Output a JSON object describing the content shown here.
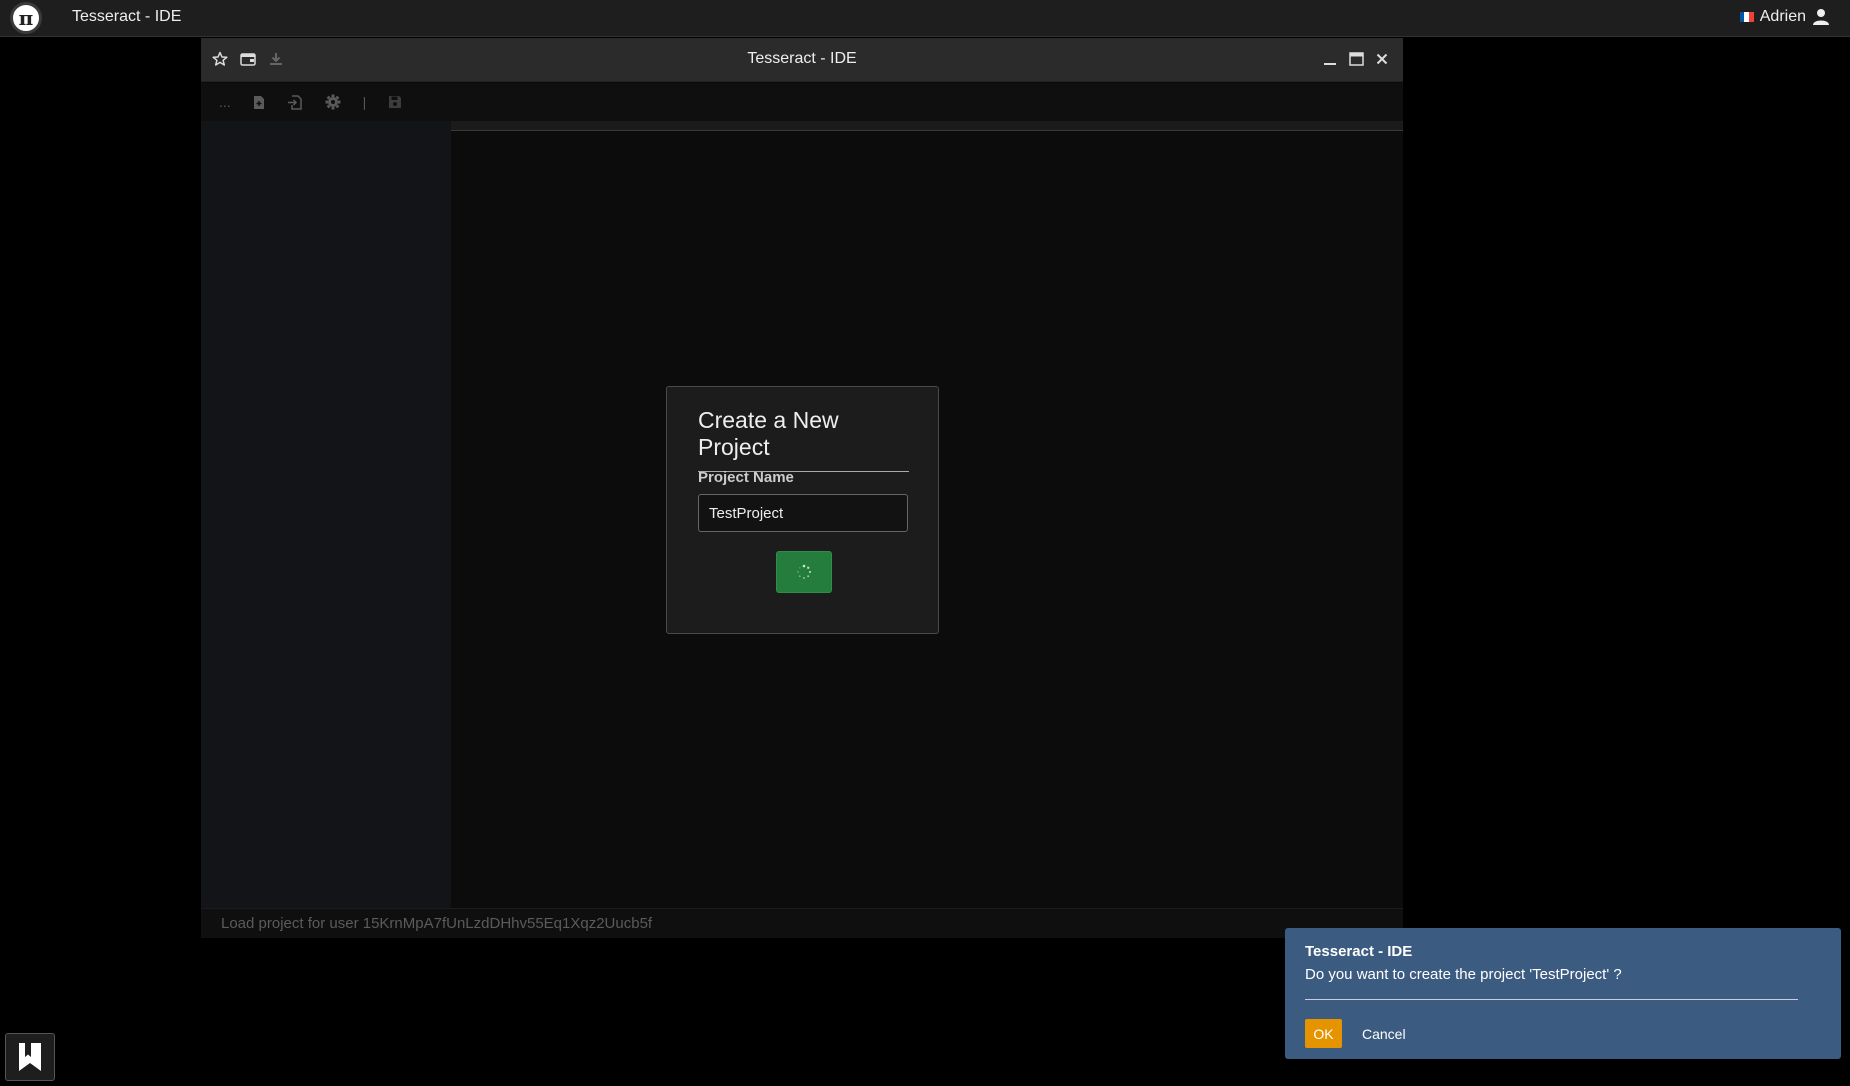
{
  "topbar": {
    "logo_glyph": "π",
    "title": "Tesseract - IDE",
    "user_name": "Adrien",
    "flag_colors": [
      "#0055a4",
      "#ffffff",
      "#ef4135"
    ]
  },
  "window": {
    "title": "Tesseract - IDE",
    "titlebar_left_icons": [
      "star-icon",
      "folder-icon",
      "download-icon"
    ],
    "titlebar_right_icons": [
      "minimize-icon",
      "maximize-icon",
      "close-icon"
    ],
    "toolbar": {
      "more_label": "...",
      "icons": [
        "new-file-icon",
        "import-file-icon",
        "settings-icon",
        "save-icon"
      ],
      "separator": "|"
    },
    "status_text": "Load project for user 15KrnMpA7fUnLzdDHhv55Eq1Xqz2Uucb5f"
  },
  "dialog": {
    "title": "Create a New Project",
    "field_label": "Project Name",
    "field_value": "TestProject",
    "button_state": "loading-spinner-icon",
    "button_color": "#247c3d"
  },
  "notification": {
    "title": "Tesseract - IDE",
    "message": "Do you want to create the project 'TestProject' ?",
    "ok_label": "OK",
    "cancel_label": "Cancel",
    "background_color": "#3b5b80",
    "ok_color": "#e59400"
  },
  "dock": {
    "bookmark_icon": "bookmark-icon"
  }
}
